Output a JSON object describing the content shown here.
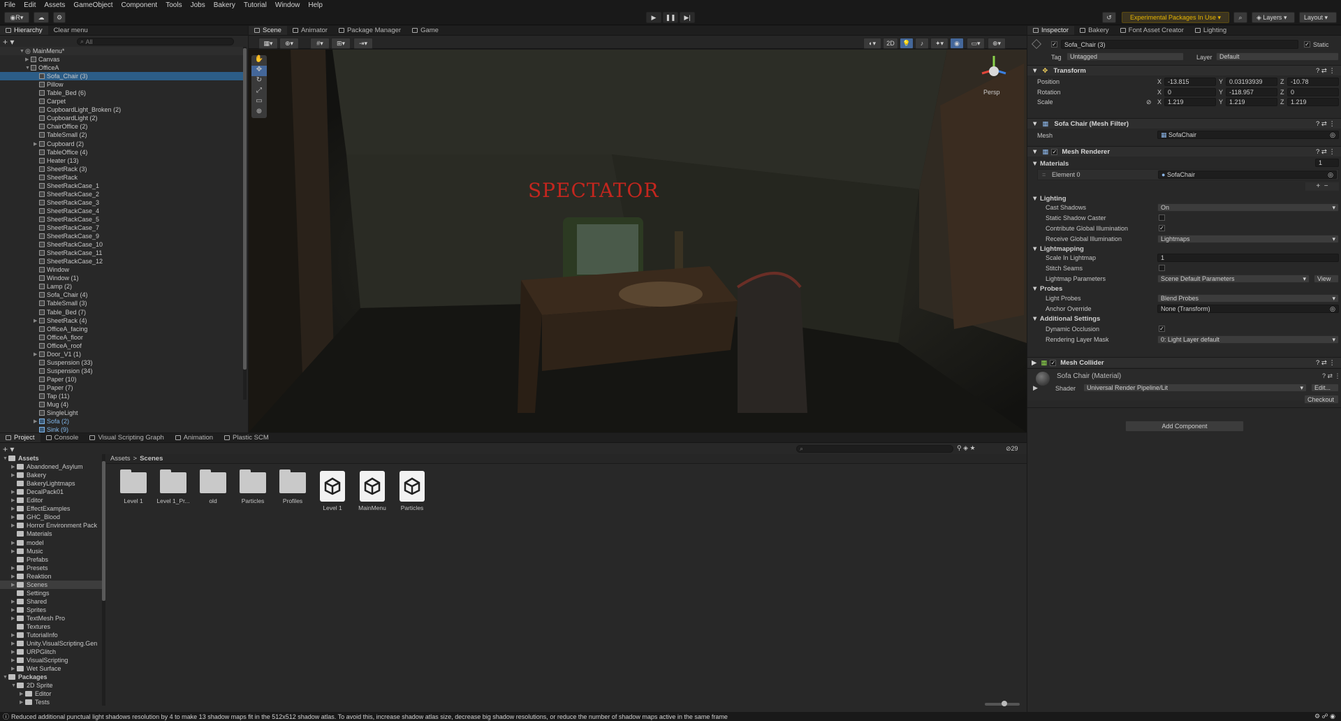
{
  "menu": [
    "File",
    "Edit",
    "Assets",
    "GameObject",
    "Component",
    "Tools",
    "Jobs",
    "Bakery",
    "Tutorial",
    "Window",
    "Help"
  ],
  "toolbar": {
    "account": "R",
    "experimental": "Experimental Packages In Use",
    "layers": "Layers",
    "layout": "Layout"
  },
  "hierarchy": {
    "tab": "Hierarchy",
    "clear_menu": "Clear menu",
    "search_placeholder": "All",
    "scene": "MainMenu*",
    "items": [
      {
        "label": "Canvas",
        "indent": 2,
        "exp": "▶"
      },
      {
        "label": "OfficeA",
        "indent": 2,
        "exp": "▼"
      },
      {
        "label": "Sofa_Chair (3)",
        "indent": 3,
        "exp": "",
        "selected": true
      },
      {
        "label": "Pillow",
        "indent": 3,
        "exp": ""
      },
      {
        "label": "Table_Bed (6)",
        "indent": 3,
        "exp": ""
      },
      {
        "label": "Carpet",
        "indent": 3,
        "exp": ""
      },
      {
        "label": "CupboardLight_Broken (2)",
        "indent": 3,
        "exp": ""
      },
      {
        "label": "CupboardLight (2)",
        "indent": 3,
        "exp": ""
      },
      {
        "label": "ChairOffice (2)",
        "indent": 3,
        "exp": ""
      },
      {
        "label": "TableSmall (2)",
        "indent": 3,
        "exp": ""
      },
      {
        "label": "Cupboard (2)",
        "indent": 3,
        "exp": "▶"
      },
      {
        "label": "TableOffice (4)",
        "indent": 3,
        "exp": ""
      },
      {
        "label": "Heater (13)",
        "indent": 3,
        "exp": ""
      },
      {
        "label": "SheetRack (3)",
        "indent": 3,
        "exp": ""
      },
      {
        "label": "SheetRack",
        "indent": 3,
        "exp": ""
      },
      {
        "label": "SheetRackCase_1",
        "indent": 3,
        "exp": ""
      },
      {
        "label": "SheetRackCase_2",
        "indent": 3,
        "exp": ""
      },
      {
        "label": "SheetRackCase_3",
        "indent": 3,
        "exp": ""
      },
      {
        "label": "SheetRackCase_4",
        "indent": 3,
        "exp": ""
      },
      {
        "label": "SheetRackCase_5",
        "indent": 3,
        "exp": ""
      },
      {
        "label": "SheetRackCase_7",
        "indent": 3,
        "exp": ""
      },
      {
        "label": "SheetRackCase_9",
        "indent": 3,
        "exp": ""
      },
      {
        "label": "SheetRackCase_10",
        "indent": 3,
        "exp": ""
      },
      {
        "label": "SheetRackCase_11",
        "indent": 3,
        "exp": ""
      },
      {
        "label": "SheetRackCase_12",
        "indent": 3,
        "exp": ""
      },
      {
        "label": "Window",
        "indent": 3,
        "exp": ""
      },
      {
        "label": "Window (1)",
        "indent": 3,
        "exp": ""
      },
      {
        "label": "Lamp (2)",
        "indent": 3,
        "exp": ""
      },
      {
        "label": "Sofa_Chair (4)",
        "indent": 3,
        "exp": ""
      },
      {
        "label": "TableSmall (3)",
        "indent": 3,
        "exp": ""
      },
      {
        "label": "Table_Bed (7)",
        "indent": 3,
        "exp": ""
      },
      {
        "label": "SheetRack (4)",
        "indent": 3,
        "exp": "▶"
      },
      {
        "label": "OfficeA_facing",
        "indent": 3,
        "exp": ""
      },
      {
        "label": "OfficeA_floor",
        "indent": 3,
        "exp": ""
      },
      {
        "label": "OfficeA_roof",
        "indent": 3,
        "exp": ""
      },
      {
        "label": "Door_V1 (1)",
        "indent": 3,
        "exp": "▶"
      },
      {
        "label": "Suspension (33)",
        "indent": 3,
        "exp": ""
      },
      {
        "label": "Suspension (34)",
        "indent": 3,
        "exp": ""
      },
      {
        "label": "Paper (10)",
        "indent": 3,
        "exp": ""
      },
      {
        "label": "Paper (7)",
        "indent": 3,
        "exp": ""
      },
      {
        "label": "Tap (11)",
        "indent": 3,
        "exp": ""
      },
      {
        "label": "Mug (4)",
        "indent": 3,
        "exp": ""
      },
      {
        "label": "SingleLight",
        "indent": 3,
        "exp": ""
      },
      {
        "label": "Sofa (2)",
        "indent": 3,
        "exp": "▶",
        "prefab": true
      },
      {
        "label": "Sink (9)",
        "indent": 3,
        "exp": "",
        "prefab": true
      }
    ]
  },
  "scene_view": {
    "tabs": [
      "Scene",
      "Animator",
      "Package Manager",
      "Game"
    ],
    "mode_2d": "2D",
    "persp": "Persp",
    "sign_text": "SPECTATOR"
  },
  "project": {
    "tabs": [
      "Project",
      "Console",
      "Visual Scripting Graph",
      "Animation",
      "Plastic SCM"
    ],
    "hidden_count": "29",
    "breadcrumb": [
      "Assets",
      "Scenes"
    ],
    "tree": [
      {
        "label": "Assets",
        "indent": 0,
        "exp": "▼",
        "bold": true
      },
      {
        "label": "Abandoned_Asylum",
        "indent": 1,
        "exp": "▶"
      },
      {
        "label": "Bakery",
        "indent": 1,
        "exp": "▶"
      },
      {
        "label": "BakeryLightmaps",
        "indent": 1,
        "exp": ""
      },
      {
        "label": "DecalPack01",
        "indent": 1,
        "exp": "▶"
      },
      {
        "label": "Editor",
        "indent": 1,
        "exp": "▶"
      },
      {
        "label": "EffectExamples",
        "indent": 1,
        "exp": "▶"
      },
      {
        "label": "GHC_Blood",
        "indent": 1,
        "exp": "▶"
      },
      {
        "label": "Horror Environment Pack",
        "indent": 1,
        "exp": "▶"
      },
      {
        "label": "Materials",
        "indent": 1,
        "exp": ""
      },
      {
        "label": "model",
        "indent": 1,
        "exp": "▶"
      },
      {
        "label": "Music",
        "indent": 1,
        "exp": "▶"
      },
      {
        "label": "Prefabs",
        "indent": 1,
        "exp": ""
      },
      {
        "label": "Presets",
        "indent": 1,
        "exp": "▶"
      },
      {
        "label": "Reaktion",
        "indent": 1,
        "exp": "▶"
      },
      {
        "label": "Scenes",
        "indent": 1,
        "exp": "▶",
        "selected": true
      },
      {
        "label": "Settings",
        "indent": 1,
        "exp": ""
      },
      {
        "label": "Shared",
        "indent": 1,
        "exp": "▶"
      },
      {
        "label": "Sprites",
        "indent": 1,
        "exp": "▶"
      },
      {
        "label": "TextMesh Pro",
        "indent": 1,
        "exp": "▶"
      },
      {
        "label": "Textures",
        "indent": 1,
        "exp": ""
      },
      {
        "label": "TutorialInfo",
        "indent": 1,
        "exp": "▶"
      },
      {
        "label": "Unity.VisualScripting.Gen",
        "indent": 1,
        "exp": "▶"
      },
      {
        "label": "URPGlitch",
        "indent": 1,
        "exp": "▶"
      },
      {
        "label": "VisualScripting",
        "indent": 1,
        "exp": "▶"
      },
      {
        "label": "Wet Surface",
        "indent": 1,
        "exp": "▶"
      },
      {
        "label": "Packages",
        "indent": 0,
        "exp": "▼",
        "bold": true
      },
      {
        "label": "2D Sprite",
        "indent": 1,
        "exp": "▼"
      },
      {
        "label": "Editor",
        "indent": 2,
        "exp": "▶"
      },
      {
        "label": "Tests",
        "indent": 2,
        "exp": "▶"
      }
    ],
    "files": [
      {
        "label": "Level 1",
        "kind": "folder"
      },
      {
        "label": "Level 1_Pr...",
        "kind": "folder"
      },
      {
        "label": "old",
        "kind": "folder"
      },
      {
        "label": "Particles",
        "kind": "folder"
      },
      {
        "label": "Profiles",
        "kind": "folder"
      },
      {
        "label": "Level 1",
        "kind": "scene"
      },
      {
        "label": "MainMenu",
        "kind": "scene"
      },
      {
        "label": "Particles",
        "kind": "scene"
      }
    ]
  },
  "inspector": {
    "tabs": [
      "Inspector",
      "Bakery",
      "Font Asset Creator",
      "Lighting"
    ],
    "object_name": "Sofa_Chair (3)",
    "static_label": "Static",
    "tag_label": "Tag",
    "tag_value": "Untagged",
    "layer_label": "Layer",
    "layer_value": "Default",
    "transform": {
      "title": "Transform",
      "position": {
        "label": "Position",
        "x": "-13.815",
        "y": "0.03193939",
        "z": "-10.78"
      },
      "rotation": {
        "label": "Rotation",
        "x": "0",
        "y": "-118.957",
        "z": "0"
      },
      "scale": {
        "label": "Scale",
        "x": "1.219",
        "y": "1.219",
        "z": "1.219"
      }
    },
    "mesh_filter": {
      "title": "Sofa Chair (Mesh Filter)",
      "mesh_label": "Mesh",
      "mesh_value": "SofaChair"
    },
    "mesh_renderer": {
      "title": "Mesh Renderer",
      "materials_label": "Materials",
      "materials_count": "1",
      "element_label": "Element 0",
      "element_value": "SofaChair",
      "lighting": "Lighting",
      "cast_shadows_label": "Cast Shadows",
      "cast_shadows_value": "On",
      "static_shadow_label": "Static Shadow Caster",
      "contribute_gi_label": "Contribute Global Illumination",
      "receive_gi_label": "Receive Global Illumination",
      "receive_gi_value": "Lightmaps",
      "lightmapping": "Lightmapping",
      "scale_lightmap_label": "Scale In Lightmap",
      "scale_lightmap_value": "1",
      "stitch_label": "Stitch Seams",
      "lm_params_label": "Lightmap Parameters",
      "lm_params_value": "Scene Default Parameters",
      "view_btn": "View",
      "probes": "Probes",
      "light_probes_label": "Light Probes",
      "light_probes_value": "Blend Probes",
      "anchor_label": "Anchor Override",
      "anchor_value": "None (Transform)",
      "additional": "Additional Settings",
      "dynamic_occ_label": "Dynamic Occlusion",
      "rendering_layer_label": "Rendering Layer Mask",
      "rendering_layer_value": "0: Light Layer default"
    },
    "mesh_collider": {
      "title": "Mesh Collider"
    },
    "material": {
      "title": "Sofa Chair (Material)",
      "shader_label": "Shader",
      "shader_value": "Universal Render Pipeline/Lit",
      "edit_btn": "Edit...",
      "checkout_btn": "Checkout"
    },
    "add_component": "Add Component"
  },
  "status_message": "Reduced additional punctual light shadows resolution by 4 to make 13 shadow maps fit in the 512x512 shadow atlas. To avoid this, increase shadow atlas size, decrease big shadow resolutions, or reduce the number of shadow maps active in the same frame",
  "colors": {
    "accent": "#2c5d87",
    "selection": "#2c5d87",
    "experimental": "#d8a400",
    "sign": "#c4261e"
  }
}
